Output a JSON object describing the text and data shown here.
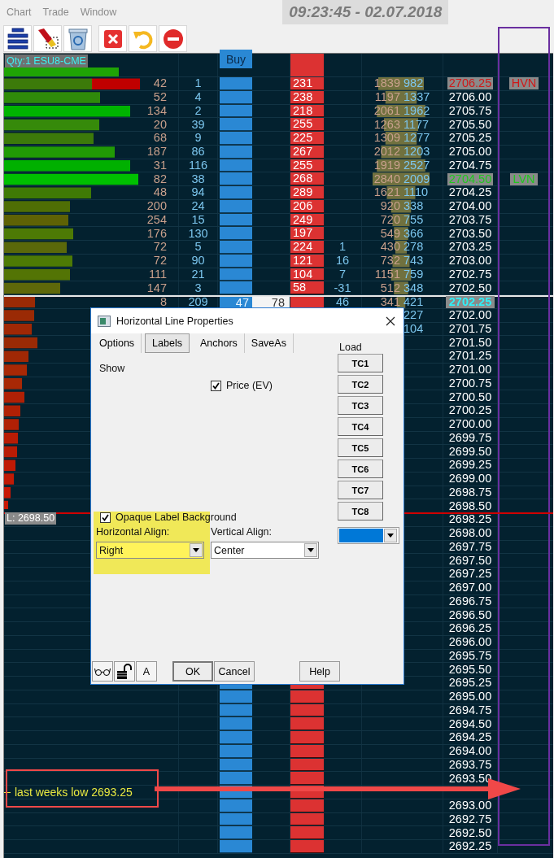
{
  "menu": [
    {
      "label": "Chart"
    },
    {
      "label": "Trade"
    },
    {
      "label": "Window"
    }
  ],
  "clock": "09:23:45 - 02.07.2018",
  "toolbar": [
    {
      "kind": "lines"
    },
    {
      "kind": "brush"
    },
    {
      "kind": "recycle"
    },
    {
      "kind": "close"
    },
    {
      "kind": "undo"
    },
    {
      "kind": "stop"
    }
  ],
  "ladder": {
    "qty_label": "Qty:1 ESU8-CME",
    "buy_header": "Buy",
    "rows": [
      {
        "kind": "hvn",
        "price": "2706.25",
        "node": {
          "label": "HVN",
          "kind": "hvn"
        },
        "column_2": "42",
        "column_3": "1",
        "column_6": "231",
        "column_8": "1839",
        "column_9": "982"
      },
      {
        "kind": "plain",
        "price": "2706.00",
        "column_2": "52",
        "column_3": "4",
        "column_6": "238",
        "column_8": "1197",
        "column_9": "1337"
      },
      {
        "kind": "plain",
        "price": "2705.75",
        "column_2": "134",
        "column_3": "2",
        "column_6": "218",
        "column_8": "2061",
        "column_9": "1962"
      },
      {
        "kind": "plain",
        "price": "2705.50",
        "column_2": "20",
        "column_3": "39",
        "column_6": "255",
        "column_8": "1263",
        "column_9": "1177"
      },
      {
        "kind": "plain",
        "price": "2705.25",
        "column_2": "68",
        "column_3": "9",
        "column_6": "225",
        "column_8": "1309",
        "column_9": "1277"
      },
      {
        "kind": "plain",
        "price": "2705.00",
        "column_2": "187",
        "column_3": "86",
        "column_6": "267",
        "column_8": "2012",
        "column_9": "1203"
      },
      {
        "kind": "plain",
        "price": "2704.75",
        "column_2": "31",
        "column_3": "116",
        "column_6": "255",
        "column_8": "1919",
        "column_9": "2527"
      },
      {
        "kind": "lvn",
        "price": "2704.50",
        "node": {
          "label": "LVN",
          "kind": "lvn"
        },
        "column_2": "82",
        "column_3": "38",
        "column_6": "268",
        "column_8": "2840",
        "column_9": "2009"
      },
      {
        "kind": "plain",
        "price": "2704.25",
        "column_2": "48",
        "column_3": "94",
        "column_6": "289",
        "column_8": "1621",
        "column_9": "1110"
      },
      {
        "kind": "plain",
        "price": "2704.00",
        "column_2": "200",
        "column_3": "24",
        "column_6": "206",
        "column_8": "920",
        "column_9": "338"
      },
      {
        "kind": "plain",
        "price": "2703.75",
        "column_2": "254",
        "column_3": "15",
        "column_6": "249",
        "column_8": "720",
        "column_9": "755"
      },
      {
        "kind": "plain",
        "price": "2703.50",
        "column_2": "176",
        "column_3": "130",
        "column_6": "197",
        "column_8": "549",
        "column_9": "366"
      },
      {
        "kind": "plain",
        "price": "2703.25",
        "column_2": "72",
        "column_3": "5",
        "column_6": "224",
        "column_7": "1",
        "column_8": "430",
        "column_9": "278"
      },
      {
        "kind": "plain",
        "price": "2703.00",
        "column_2": "72",
        "column_3": "90",
        "column_6": "121",
        "column_7": "16",
        "column_8": "732",
        "column_9": "743"
      },
      {
        "kind": "plain",
        "price": "2702.75",
        "column_2": "111",
        "column_3": "21",
        "column_6": "104",
        "column_7": "7",
        "column_8": "1151",
        "column_9": "759"
      },
      {
        "kind": "plain",
        "price": "2702.50",
        "column_2": "147",
        "column_3": "3",
        "column_6": "58",
        "column_7": "-31",
        "column_8": "512",
        "column_9": "348"
      },
      {
        "kind": "last",
        "price": "2702.25",
        "column_2": "8",
        "column_3": "209",
        "buy": "47",
        "column_5": "78",
        "column_7": "46",
        "column_8": "341",
        "column_9": "421"
      },
      {
        "kind": "plain",
        "price": "2702.00",
        "column_9": "227"
      },
      {
        "kind": "plain",
        "price": "2701.75",
        "column_9": "104"
      },
      {
        "kind": "plain",
        "price": "2701.50"
      },
      {
        "kind": "plain",
        "price": "2701.25"
      },
      {
        "kind": "plain",
        "price": "2701.00"
      },
      {
        "kind": "plain",
        "price": "2700.75"
      },
      {
        "kind": "plain",
        "price": "2700.50"
      },
      {
        "kind": "plain",
        "price": "2700.25"
      },
      {
        "kind": "plain",
        "price": "2700.00"
      },
      {
        "kind": "plain",
        "price": "2699.75"
      },
      {
        "kind": "plain",
        "price": "2699.50"
      },
      {
        "kind": "plain",
        "price": "2699.25"
      },
      {
        "kind": "plain",
        "price": "2699.00"
      },
      {
        "kind": "plain",
        "price": "2698.75"
      },
      {
        "kind": "plain",
        "price": "2698.50",
        "hline": {
          "kind": "alert",
          "label": "L: 2698.50"
        }
      },
      {
        "kind": "plain",
        "price": "2698.25"
      },
      {
        "kind": "plain",
        "price": "2698.00"
      },
      {
        "kind": "plain",
        "price": "2697.75"
      },
      {
        "kind": "plain",
        "price": "2697.50"
      },
      {
        "kind": "plain",
        "price": "2697.25"
      },
      {
        "kind": "plain",
        "price": "2697.00"
      },
      {
        "kind": "plain",
        "price": "2696.75"
      },
      {
        "kind": "plain",
        "price": "2696.50"
      },
      {
        "kind": "plain",
        "price": "2696.25"
      },
      {
        "kind": "plain",
        "price": "2696.00"
      },
      {
        "kind": "plain",
        "price": "2695.75"
      },
      {
        "kind": "plain",
        "price": "2695.50"
      },
      {
        "kind": "plain",
        "price": "2695.25"
      },
      {
        "kind": "plain",
        "price": "2695.00"
      },
      {
        "kind": "plain",
        "price": "2694.75"
      },
      {
        "kind": "plain",
        "price": "2694.50"
      },
      {
        "kind": "plain",
        "price": "2694.25"
      },
      {
        "kind": "plain",
        "price": "2694.00"
      },
      {
        "kind": "plain",
        "price": "2693.75"
      },
      {
        "kind": "plain",
        "price": "2693.50"
      },
      {
        "kind": "plain",
        "hline": {
          "kind": "note",
          "label": "last weeks low  2693.25"
        }
      },
      {
        "kind": "plain",
        "price": "2693.00"
      },
      {
        "kind": "plain",
        "price": "2692.75"
      },
      {
        "kind": "plain",
        "price": "2692.50"
      },
      {
        "kind": "plain",
        "price": "2692.25"
      }
    ]
  },
  "dialog": {
    "title": "Horizontal Line Properties",
    "tabs": [
      {
        "label": "Options",
        "selected": false
      },
      {
        "label": "Labels",
        "selected": true
      },
      {
        "label": "Anchors",
        "selected": false
      },
      {
        "label": "SaveAs",
        "selected": false
      }
    ],
    "show_label": "Show",
    "price_checkbox": {
      "label": "Price (EV)",
      "checked": true
    },
    "opaque_checkbox": {
      "label": "Opaque Label Background",
      "checked": true
    },
    "horizontal_align": {
      "label": "Horizontal Align:",
      "value": "Right"
    },
    "vertical_align": {
      "label": "Vertical Align:",
      "value": "Center"
    },
    "load_label": "Load",
    "templates": [
      "TC1",
      "TC2",
      "TC3",
      "TC4",
      "TC5",
      "TC6",
      "TC7",
      "TC8"
    ],
    "color_picker": {
      "color": "#0078d7"
    },
    "tool_buttons": [
      {
        "kind": "glasses"
      },
      {
        "kind": "lock"
      },
      {
        "kind": "text",
        "label": "A"
      }
    ],
    "buttons": [
      "OK",
      "Cancel"
    ],
    "help": "Help"
  }
}
